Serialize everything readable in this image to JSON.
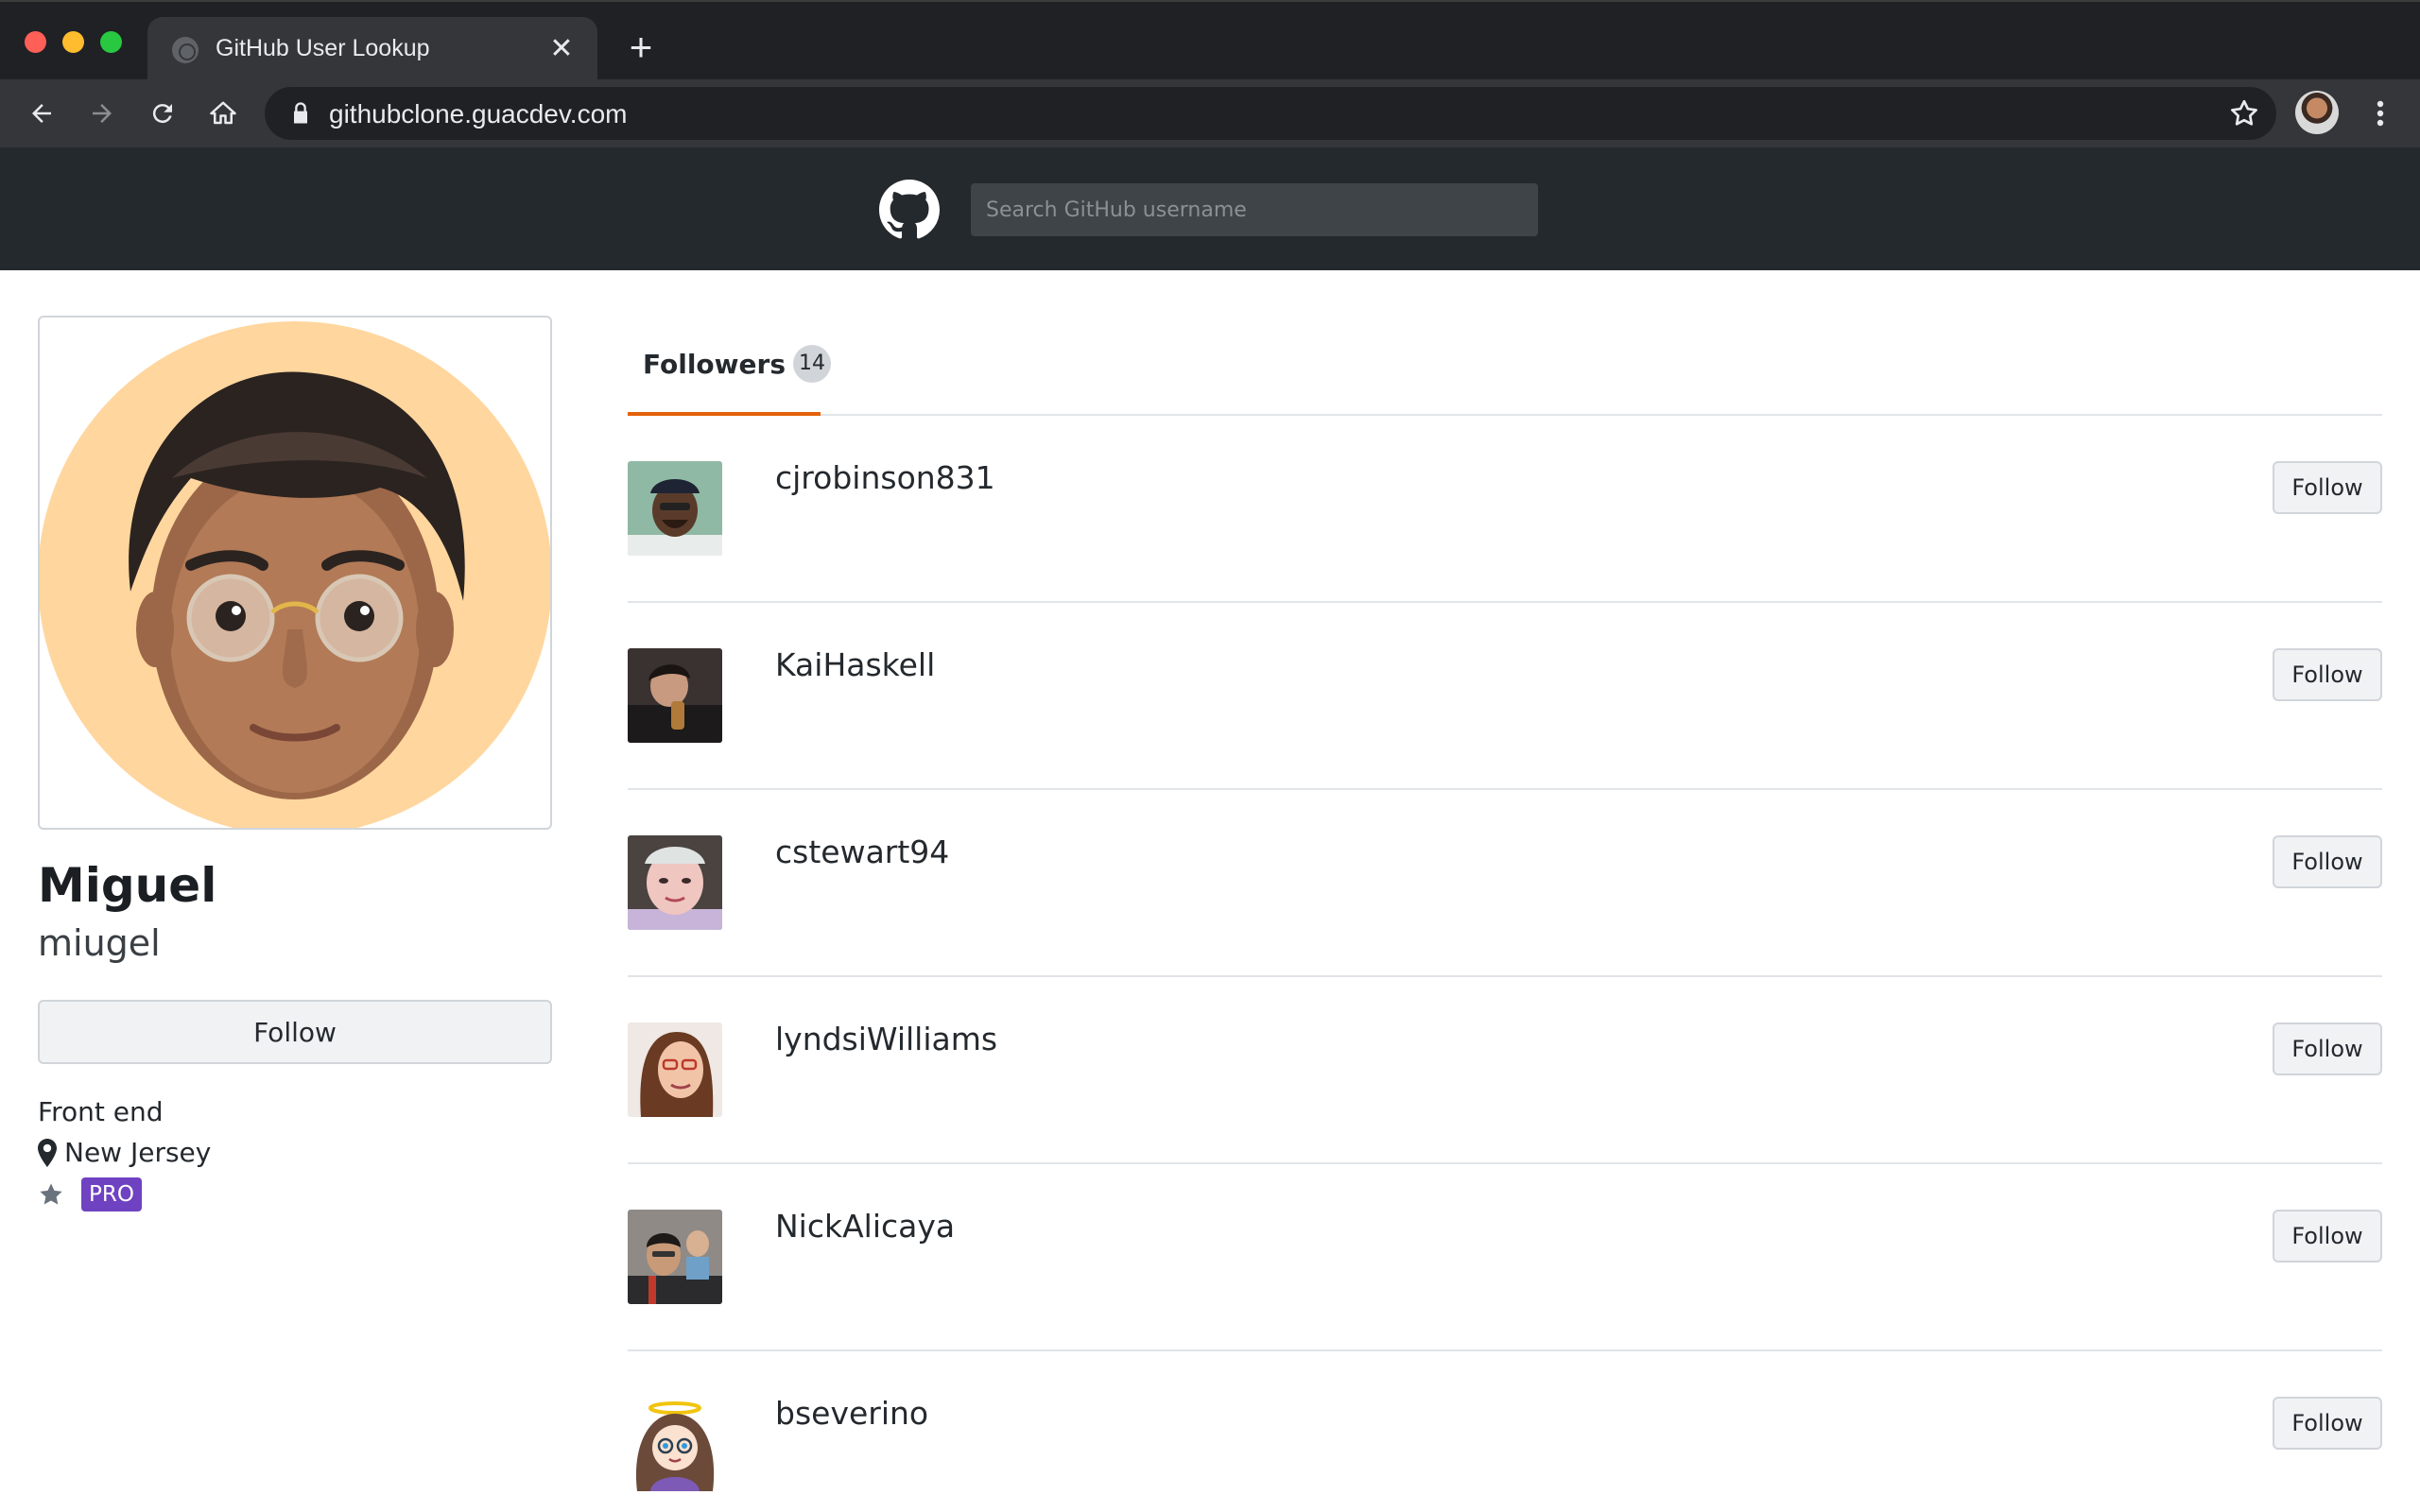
{
  "browser": {
    "tab_title": "GitHub User Lookup",
    "url": "githubclone.guacdev.com"
  },
  "header": {
    "search_placeholder": "Search GitHub username"
  },
  "profile": {
    "name": "Miguel",
    "login": "miugel",
    "follow_label": "Follow",
    "bio": "Front end",
    "location": "New Jersey",
    "badge": "PRO"
  },
  "followers_tab": {
    "label": "Followers",
    "count": "14"
  },
  "followers": [
    {
      "login": "cjrobinson831",
      "follow_label": "Follow"
    },
    {
      "login": "KaiHaskell",
      "follow_label": "Follow"
    },
    {
      "login": "cstewart94",
      "follow_label": "Follow"
    },
    {
      "login": "lyndsiWilliams",
      "follow_label": "Follow"
    },
    {
      "login": "NickAlicaya",
      "follow_label": "Follow"
    },
    {
      "login": "bseverino",
      "follow_label": "Follow"
    }
  ],
  "colors": {
    "accent_tab": "#e36209",
    "pro_badge": "#6f42c1",
    "header_bg": "#24292e"
  }
}
